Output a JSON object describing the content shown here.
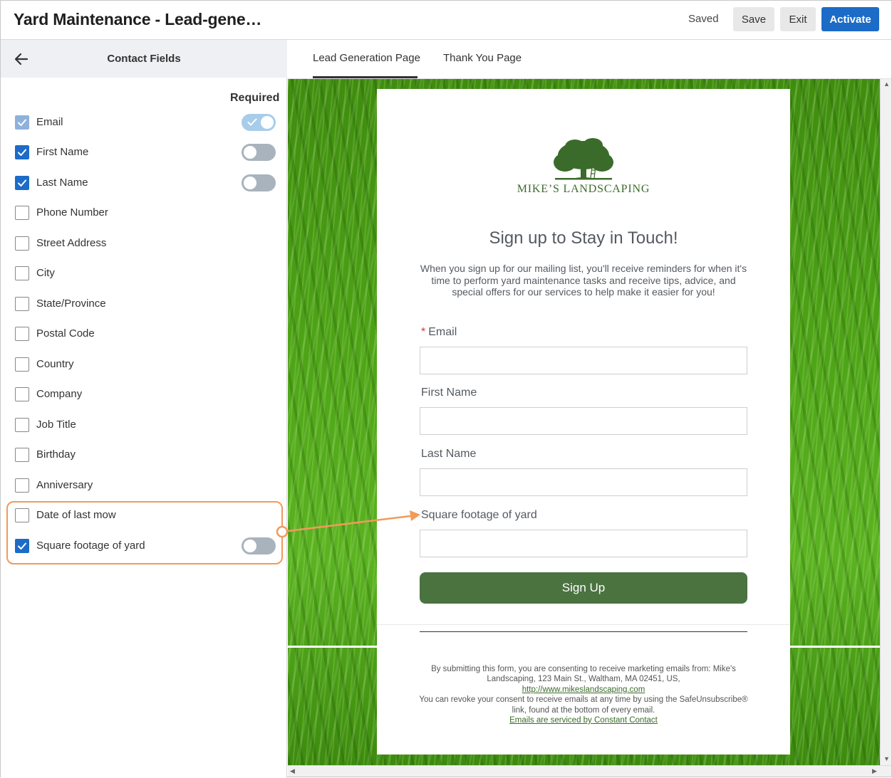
{
  "header": {
    "title": "Yard Maintenance - Lead-gene…",
    "status": "Saved",
    "save_label": "Save",
    "exit_label": "Exit",
    "activate_label": "Activate"
  },
  "sidebar": {
    "title": "Contact Fields",
    "required_label": "Required",
    "fields": [
      {
        "label": "Email",
        "checked": true,
        "disabled": true,
        "toggle": "on"
      },
      {
        "label": "First Name",
        "checked": true,
        "toggle": "off"
      },
      {
        "label": "Last Name",
        "checked": true,
        "toggle": "off"
      },
      {
        "label": "Phone Number",
        "checked": false
      },
      {
        "label": "Street Address",
        "checked": false
      },
      {
        "label": "City",
        "checked": false
      },
      {
        "label": "State/Province",
        "checked": false
      },
      {
        "label": "Postal Code",
        "checked": false
      },
      {
        "label": "Country",
        "checked": false
      },
      {
        "label": "Company",
        "checked": false
      },
      {
        "label": "Job Title",
        "checked": false
      },
      {
        "label": "Birthday",
        "checked": false
      },
      {
        "label": "Anniversary",
        "checked": false
      },
      {
        "label": "Date of last mow",
        "checked": false
      },
      {
        "label": "Square footage of yard",
        "checked": true,
        "toggle": "off"
      }
    ]
  },
  "tabs": [
    {
      "label": "Lead Generation Page",
      "active": true
    },
    {
      "label": "Thank You Page",
      "active": false
    }
  ],
  "form": {
    "logo_text": "MIKE’S LANDSCAPING",
    "heading": "Sign up to Stay in Touch!",
    "intro": "When you sign up for our mailing list, you'll receive reminders for when it's time to perform yard maintenance tasks and receive tips, advice, and special offers for our services to help make it easier for you!",
    "required_marker": "*",
    "fields": [
      {
        "label": "Email",
        "required": true
      },
      {
        "label": "First Name"
      },
      {
        "label": "Last Name"
      },
      {
        "label": "Square footage of yard"
      }
    ],
    "button_label": "Sign Up",
    "consent_line1": "By submitting this form, you are consenting to receive marketing emails from: Mike's Landscaping, 123 Main St., Waltham, MA 02451, US,",
    "consent_link": "http://www.mikeslandscaping.com",
    "consent_line2": "You can revoke your consent to receive emails at any time by using the SafeUnsubscribe® link, found at the bottom of every email.",
    "service_link": "Emails are serviced by Constant Contact"
  },
  "colors": {
    "accent": "#1c6bc7",
    "highlight": "#f29a5a",
    "form_button": "#4a7340",
    "logo_green": "#3b6b2a"
  },
  "icons": {
    "back": "arrow-left-icon",
    "check": "check-icon",
    "logo": "tree-icon"
  }
}
